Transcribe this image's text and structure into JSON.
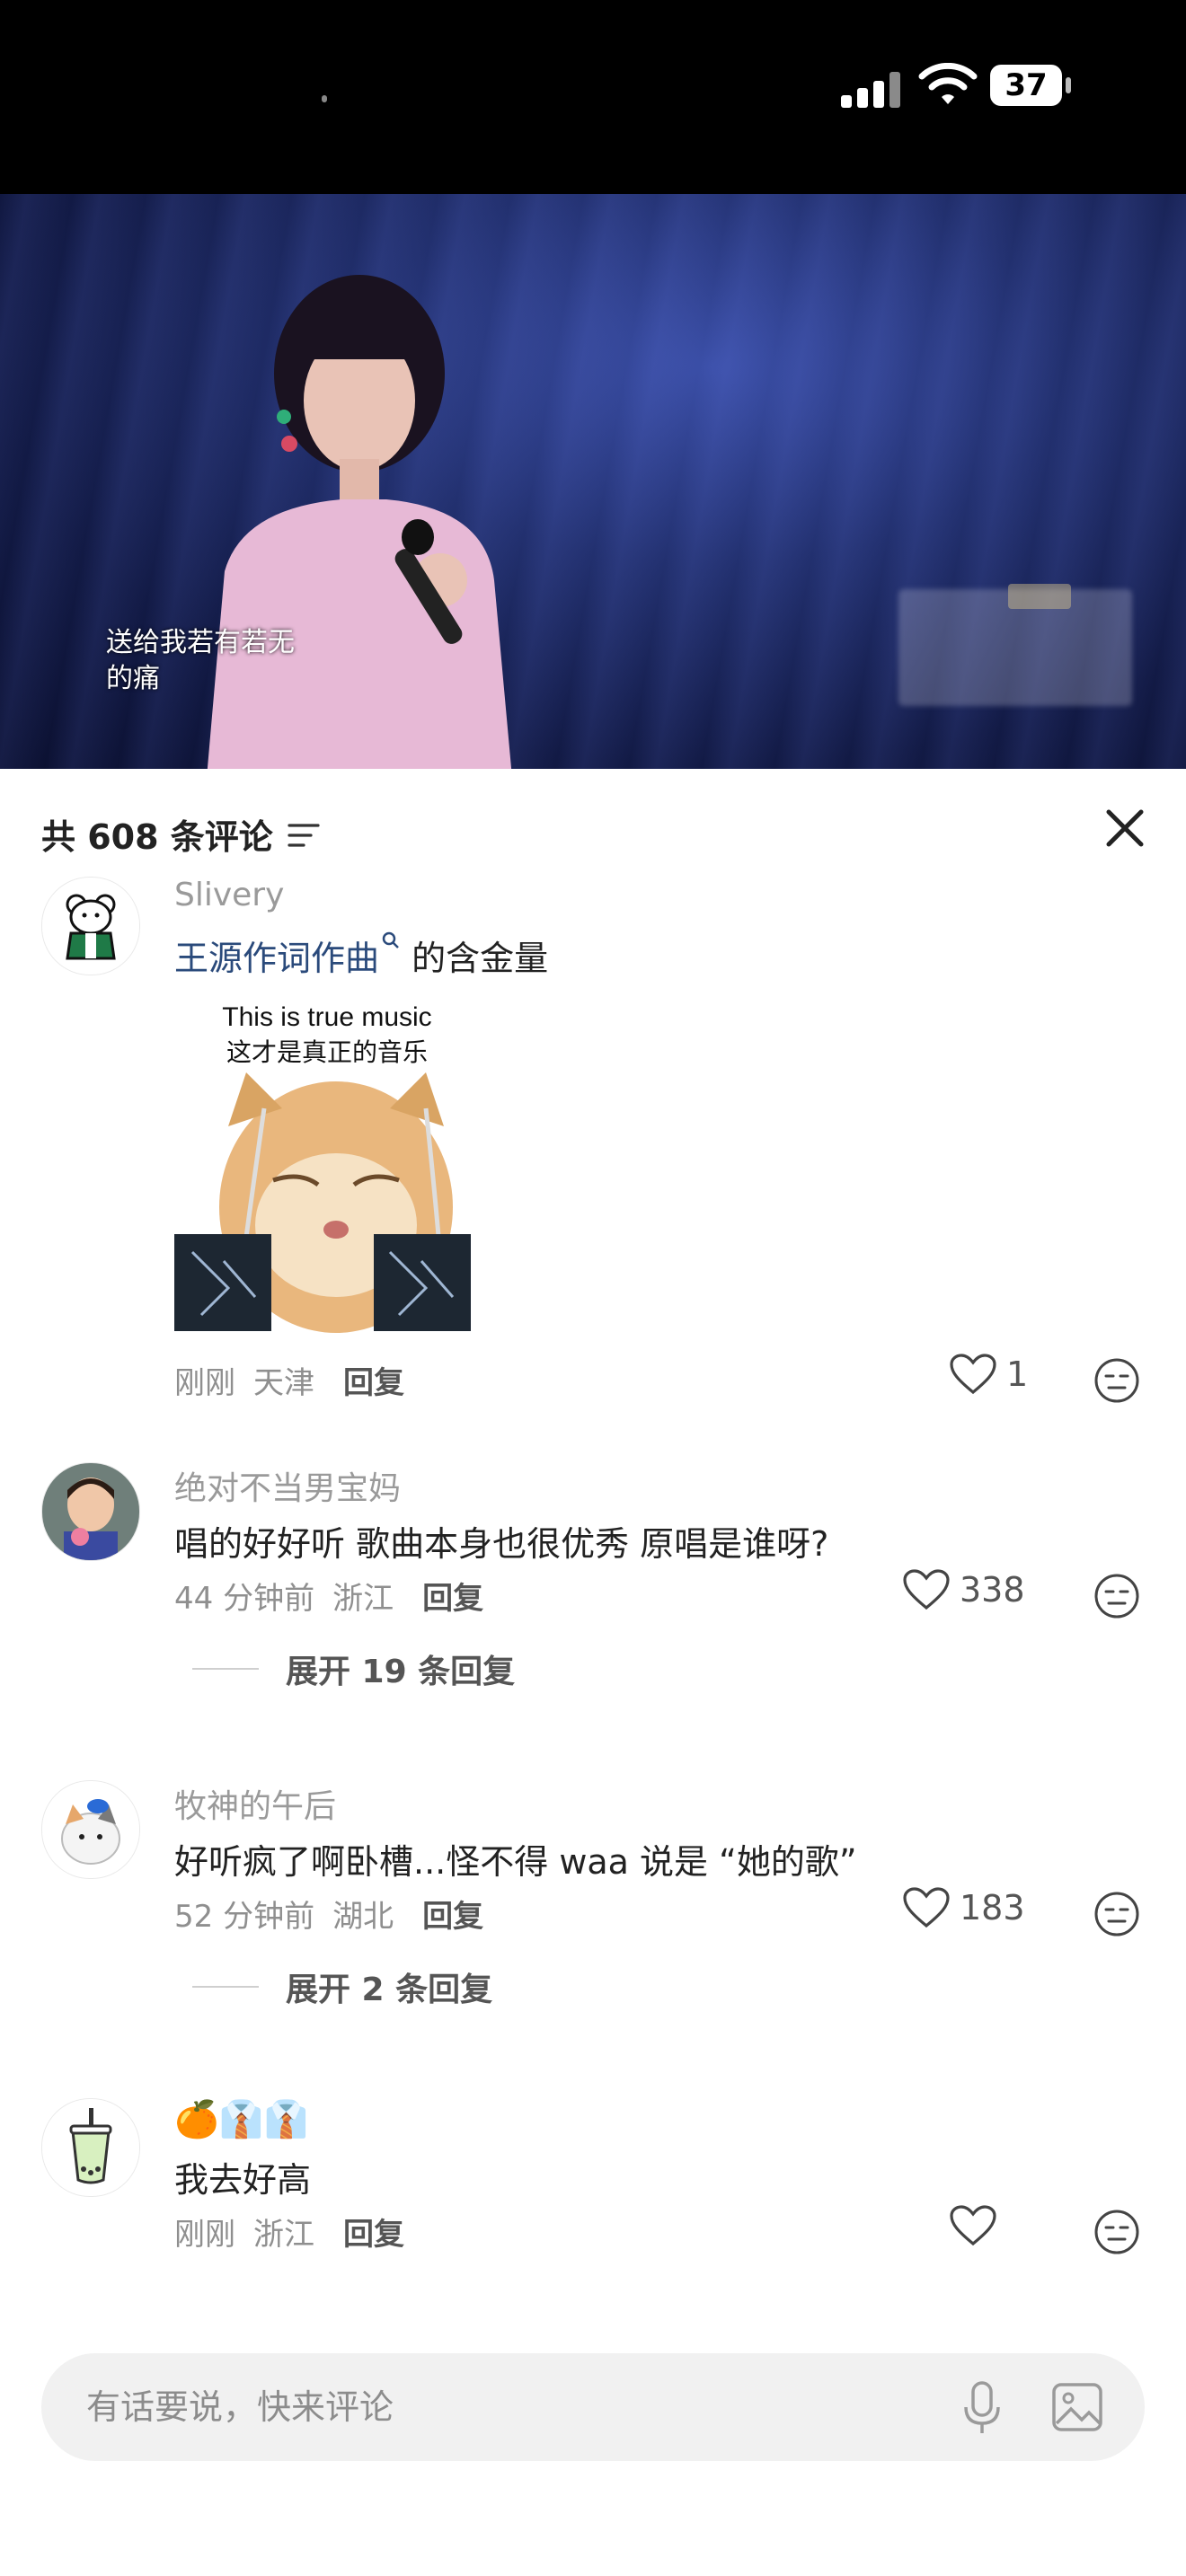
{
  "status_bar": {
    "battery": "37"
  },
  "video": {
    "subtitle_lines": [
      "送给我若有若无",
      "的痛"
    ]
  },
  "panel": {
    "count_label": "共 608 条评论"
  },
  "comments": [
    {
      "user": "Slivery",
      "text_link": "王源作词作曲",
      "text_rest": "的含金量",
      "sticker_caption_en": "This is true music",
      "sticker_caption_zh": "这才是真正的音乐",
      "time": "刚刚",
      "location": "天津",
      "reply": "回复",
      "likes": "1"
    },
    {
      "user": "绝对不当男宝妈",
      "text": "唱的好好听  歌曲本身也很优秀  原唱是谁呀?",
      "time": "44 分钟前",
      "location": "浙江",
      "reply": "回复",
      "likes": "338",
      "expand": "展开 19 条回复"
    },
    {
      "user": "牧神的午后",
      "text": "好听疯了啊卧槽...怪不得 waa 说是 “她的歌”",
      "time": "52 分钟前",
      "location": "湖北",
      "reply": "回复",
      "likes": "183",
      "expand": "展开 2 条回复"
    },
    {
      "user": "🍊👔👔",
      "text": "我去好高",
      "time": "刚刚",
      "location": "浙江",
      "reply": "回复",
      "likes": ""
    }
  ],
  "input": {
    "placeholder": "有话要说，快来评论"
  },
  "icons": [
    "signal-icon",
    "wifi-icon",
    "battery-icon",
    "sort-icon",
    "close-icon",
    "heart-icon",
    "emoji-face-icon",
    "mic-icon",
    "image-icon"
  ]
}
